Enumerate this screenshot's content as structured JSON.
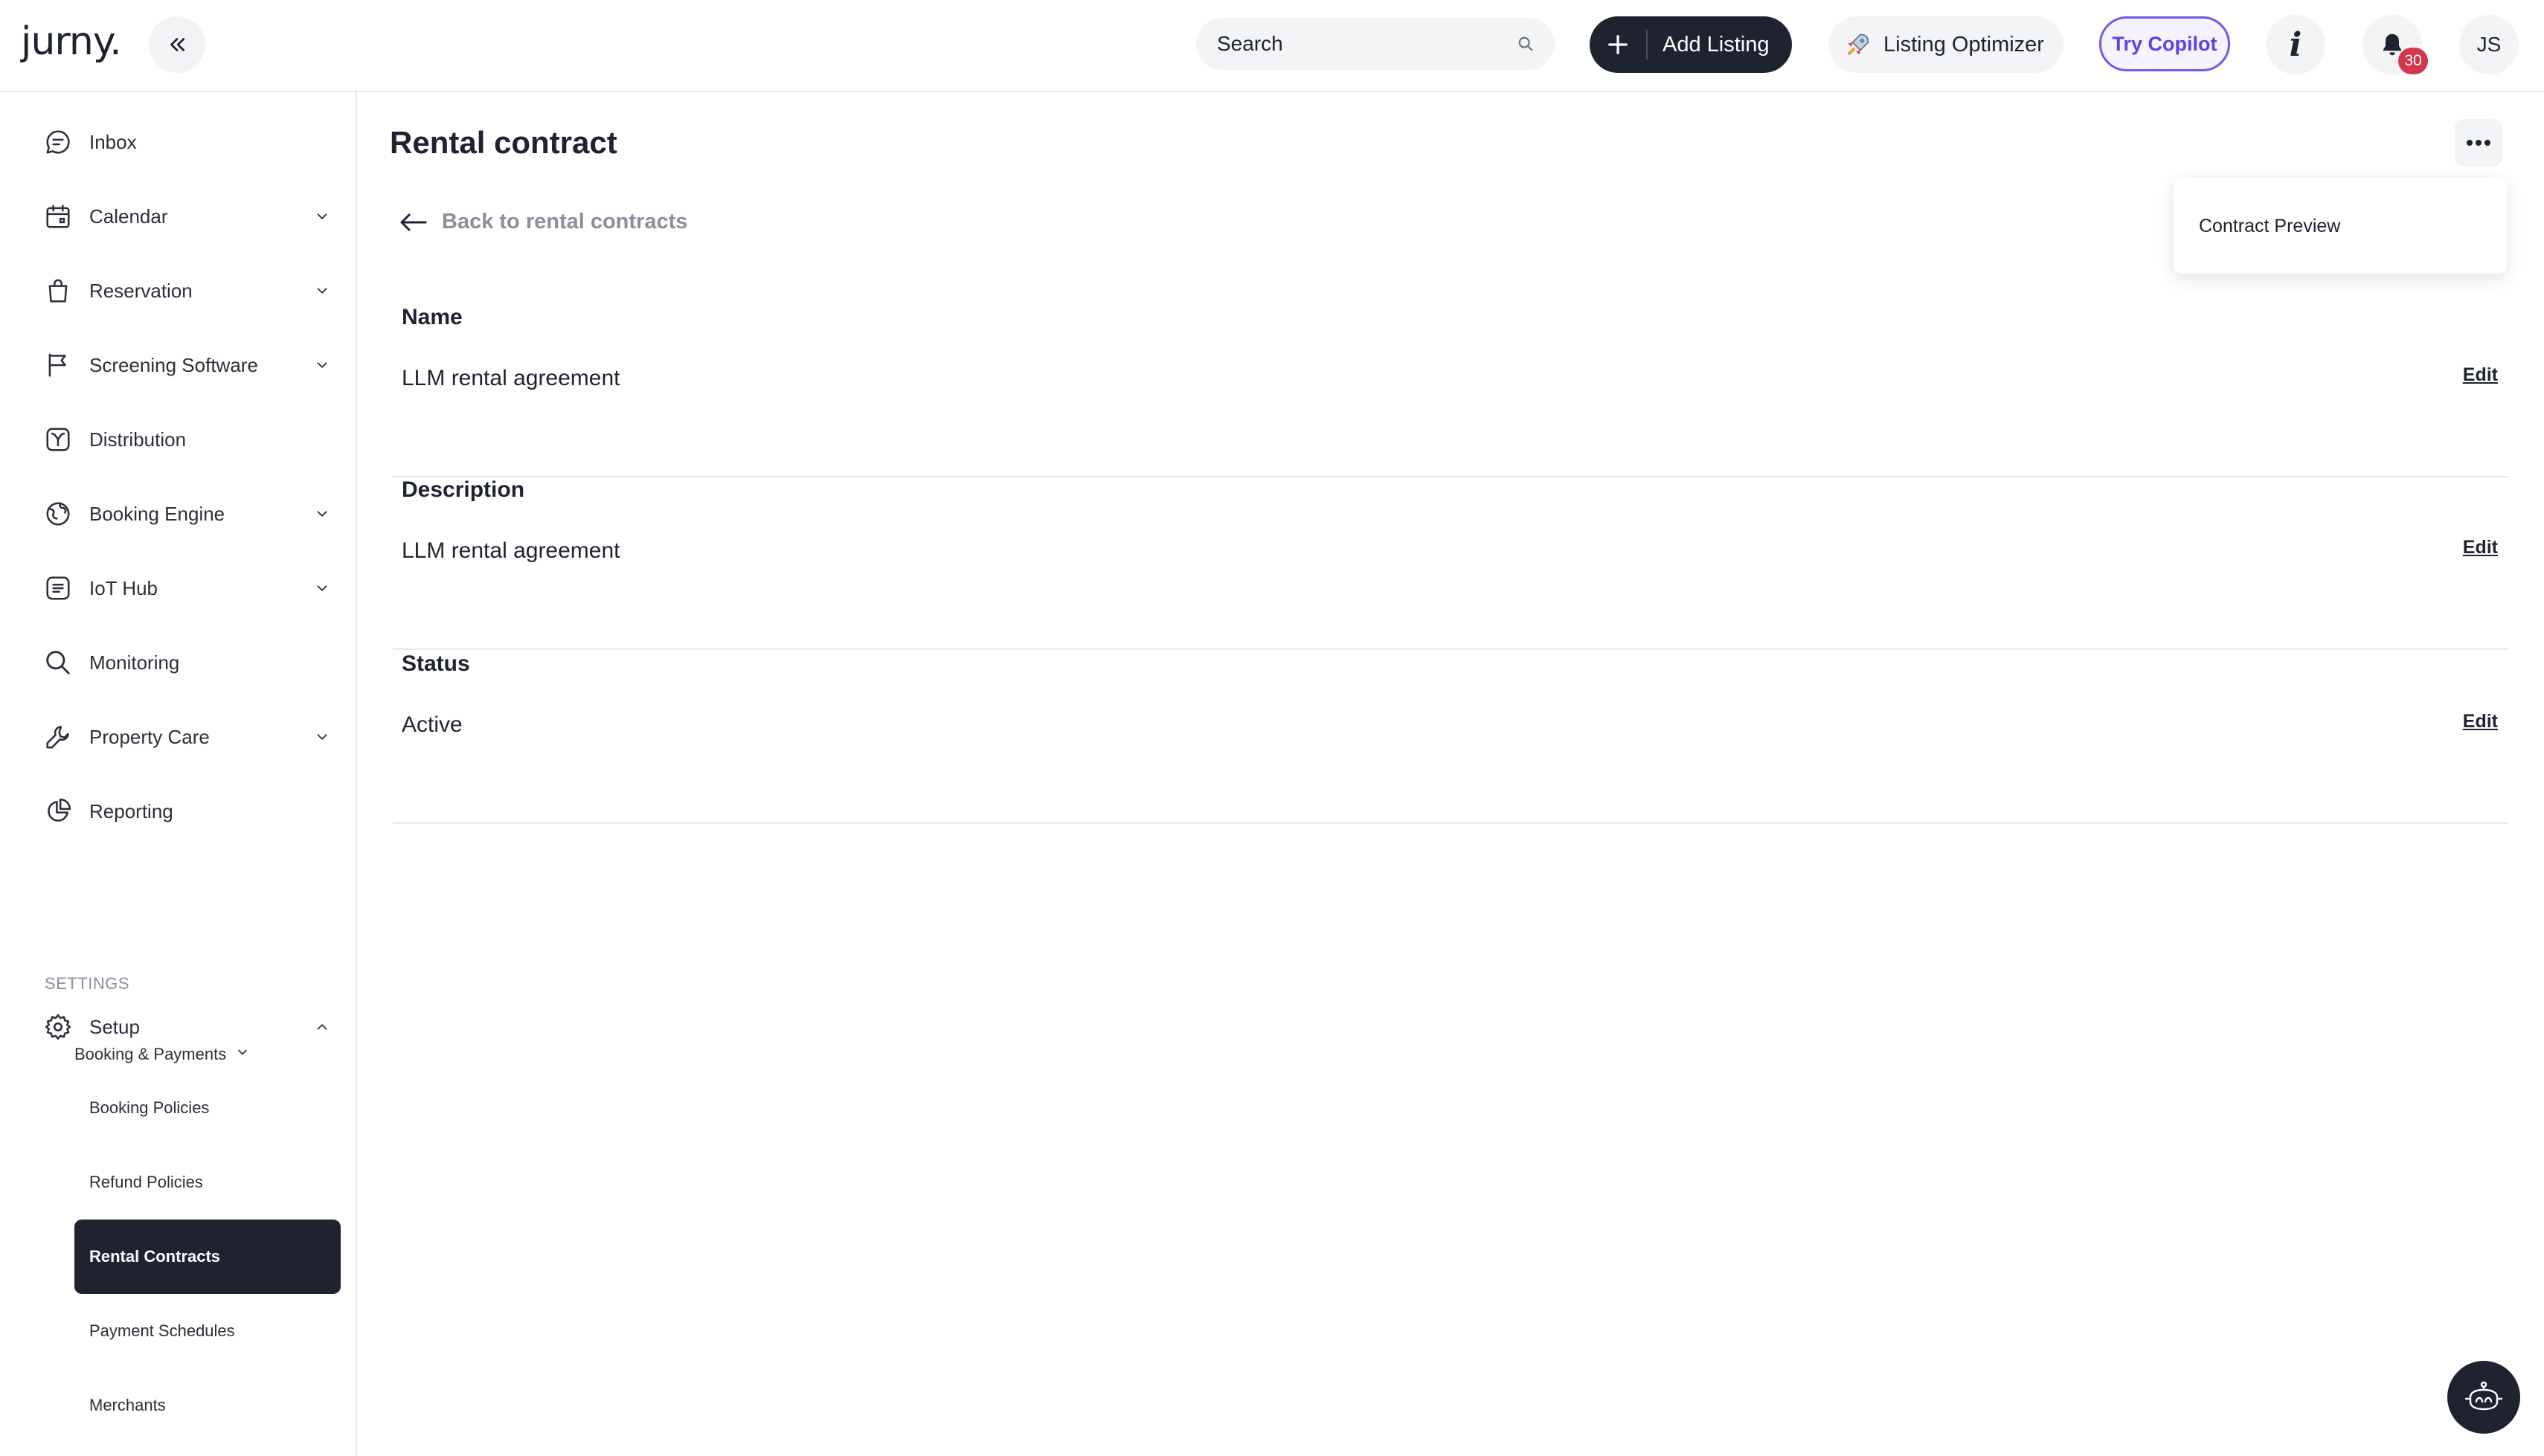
{
  "header": {
    "logo_text": "jurny.",
    "search_placeholder": "Search",
    "add_listing_label": "Add Listing",
    "optimizer_label": "Listing Optimizer",
    "copilot_label": "Try Copilot",
    "notification_count": "30",
    "avatar_initials": "JS"
  },
  "sidebar": {
    "items": [
      {
        "label": "Inbox",
        "icon": "chat-bubble-icon",
        "has_chevron": false
      },
      {
        "label": "Calendar",
        "icon": "calendar-icon",
        "has_chevron": true
      },
      {
        "label": "Reservation",
        "icon": "bag-icon",
        "has_chevron": true
      },
      {
        "label": "Screening Software",
        "icon": "flag-icon",
        "has_chevron": true
      },
      {
        "label": "Distribution",
        "icon": "distribution-icon",
        "has_chevron": false
      },
      {
        "label": "Booking Engine",
        "icon": "globe-icon",
        "has_chevron": true
      },
      {
        "label": "IoT Hub",
        "icon": "iot-hub-icon",
        "has_chevron": true
      },
      {
        "label": "Monitoring",
        "icon": "magnifier-icon",
        "has_chevron": false
      },
      {
        "label": "Property Care",
        "icon": "wrench-icon",
        "has_chevron": true
      },
      {
        "label": "Reporting",
        "icon": "pie-chart-icon",
        "has_chevron": false
      }
    ],
    "settings_label": "SETTINGS",
    "setup_label": "Setup",
    "booking_payments_label": "Booking & Payments",
    "sub_items": [
      {
        "label": "Booking Policies",
        "active": false
      },
      {
        "label": "Refund Policies",
        "active": false
      },
      {
        "label": "Rental Contracts",
        "active": true
      },
      {
        "label": "Payment Schedules",
        "active": false
      },
      {
        "label": "Merchants",
        "active": false
      }
    ]
  },
  "main": {
    "title": "Rental contract",
    "back_label": "Back to rental contracts",
    "menu_option": "Contract Preview",
    "fields": [
      {
        "label": "Name",
        "value": "LLM rental agreement",
        "edit_label": "Edit"
      },
      {
        "label": "Description",
        "value": "LLM rental agreement",
        "edit_label": "Edit"
      },
      {
        "label": "Status",
        "value": "Active",
        "edit_label": "Edit"
      }
    ]
  },
  "colors": {
    "primary_dark": "#1f2330",
    "copilot_accent": "#5b44e0",
    "badge_red": "#d1384e",
    "muted_text": "#8a8f9a"
  }
}
